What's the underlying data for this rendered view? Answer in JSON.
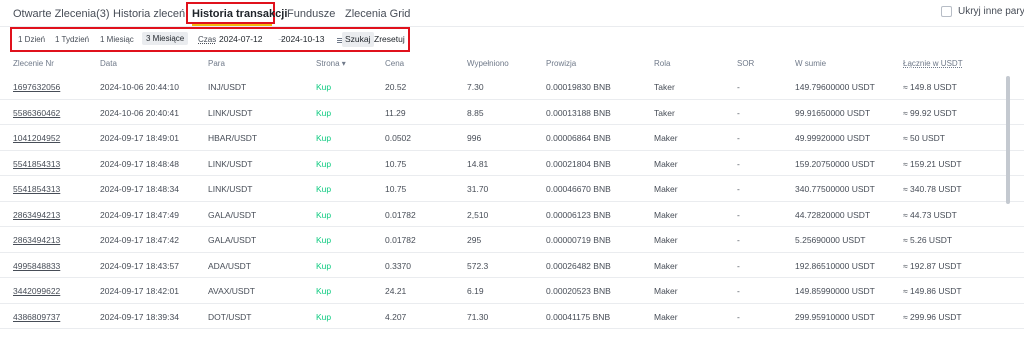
{
  "tabs": [
    {
      "label": "Otwarte Zlecenia(3)"
    },
    {
      "label": "Historia zleceń"
    },
    {
      "label": "Historia transakcji"
    },
    {
      "label": "Fundusze"
    },
    {
      "label": "Zlecenia Grid"
    }
  ],
  "hide_other_pairs": {
    "label": "Ukryj inne pary",
    "checked": false
  },
  "filters": {
    "periods": [
      {
        "label": "1 Dzień"
      },
      {
        "label": "1 Tydzień"
      },
      {
        "label": "1 Miesiąc"
      },
      {
        "label": "3 Miesiące"
      }
    ],
    "selected_period": "3 Miesiące",
    "time_label": "Czas",
    "date_from": "2024-07-12",
    "date_to": "2024-10-13",
    "arrow": "→",
    "search_label": "Szukaj",
    "reset_label": "Zresetuj"
  },
  "columns": [
    {
      "label": "Zlecenie Nr"
    },
    {
      "label": "Data"
    },
    {
      "label": "Para"
    },
    {
      "label": "Strona ▾"
    },
    {
      "label": "Cena"
    },
    {
      "label": "Wypełniono"
    },
    {
      "label": "Prowizja"
    },
    {
      "label": "Rola"
    },
    {
      "label": "SOR"
    },
    {
      "label": "W sumie"
    },
    {
      "label": "Łącznie w USDT"
    }
  ],
  "rows": [
    {
      "id": "1697632056",
      "date": "2024-10-06 20:44:10",
      "pair": "INJ/USDT",
      "side": "Kup",
      "price": "20.52",
      "filled": "7.30",
      "fee": "0.00019830 BNB",
      "role": "Taker",
      "sor": "-",
      "total": "149.79600000 USDT",
      "usdt": "≈ 149.8 USDT"
    },
    {
      "id": "5586360462",
      "date": "2024-10-06 20:40:41",
      "pair": "LINK/USDT",
      "side": "Kup",
      "price": "11.29",
      "filled": "8.85",
      "fee": "0.00013188 BNB",
      "role": "Taker",
      "sor": "-",
      "total": "99.91650000 USDT",
      "usdt": "≈ 99.92 USDT"
    },
    {
      "id": "1041204952",
      "date": "2024-09-17 18:49:01",
      "pair": "HBAR/USDT",
      "side": "Kup",
      "price": "0.0502",
      "filled": "996",
      "fee": "0.00006864 BNB",
      "role": "Maker",
      "sor": "-",
      "total": "49.99920000 USDT",
      "usdt": "≈ 50 USDT"
    },
    {
      "id": "5541854313",
      "date": "2024-09-17 18:48:48",
      "pair": "LINK/USDT",
      "side": "Kup",
      "price": "10.75",
      "filled": "14.81",
      "fee": "0.00021804 BNB",
      "role": "Maker",
      "sor": "-",
      "total": "159.20750000 USDT",
      "usdt": "≈ 159.21 USDT"
    },
    {
      "id": "5541854313",
      "date": "2024-09-17 18:48:34",
      "pair": "LINK/USDT",
      "side": "Kup",
      "price": "10.75",
      "filled": "31.70",
      "fee": "0.00046670 BNB",
      "role": "Maker",
      "sor": "-",
      "total": "340.77500000 USDT",
      "usdt": "≈ 340.78 USDT"
    },
    {
      "id": "2863494213",
      "date": "2024-09-17 18:47:49",
      "pair": "GALA/USDT",
      "side": "Kup",
      "price": "0.01782",
      "filled": "2,510",
      "fee": "0.00006123 BNB",
      "role": "Maker",
      "sor": "-",
      "total": "44.72820000 USDT",
      "usdt": "≈ 44.73 USDT"
    },
    {
      "id": "2863494213",
      "date": "2024-09-17 18:47:42",
      "pair": "GALA/USDT",
      "side": "Kup",
      "price": "0.01782",
      "filled": "295",
      "fee": "0.00000719 BNB",
      "role": "Maker",
      "sor": "-",
      "total": "5.25690000 USDT",
      "usdt": "≈ 5.26 USDT"
    },
    {
      "id": "4995848833",
      "date": "2024-09-17 18:43:57",
      "pair": "ADA/USDT",
      "side": "Kup",
      "price": "0.3370",
      "filled": "572.3",
      "fee": "0.00026482 BNB",
      "role": "Maker",
      "sor": "-",
      "total": "192.86510000 USDT",
      "usdt": "≈ 192.87 USDT"
    },
    {
      "id": "3442099622",
      "date": "2024-09-17 18:42:01",
      "pair": "AVAX/USDT",
      "side": "Kup",
      "price": "24.21",
      "filled": "6.19",
      "fee": "0.00020523 BNB",
      "role": "Maker",
      "sor": "-",
      "total": "149.85990000 USDT",
      "usdt": "≈ 149.86 USDT"
    },
    {
      "id": "4386809737",
      "date": "2024-09-17 18:39:34",
      "pair": "DOT/USDT",
      "side": "Kup",
      "price": "4.207",
      "filled": "71.30",
      "fee": "0.00041175 BNB",
      "role": "Maker",
      "sor": "-",
      "total": "299.95910000 USDT",
      "usdt": "≈ 299.96 USDT"
    }
  ]
}
